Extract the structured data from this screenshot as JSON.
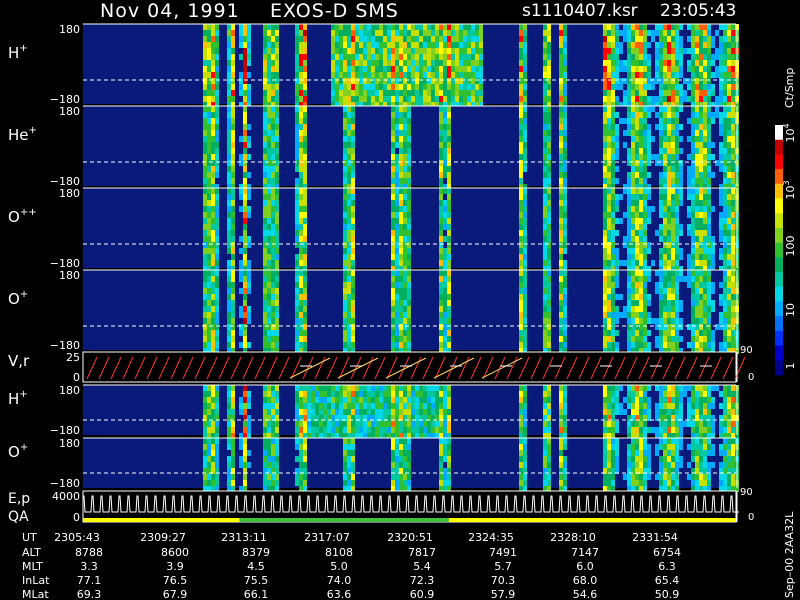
{
  "header": {
    "date": "Nov 04, 1991",
    "instrument": "EXOS-D SMS",
    "file": "s1110407.ksr",
    "time": "23:05:43"
  },
  "colorbar": {
    "unit": "Ct/Smp",
    "ticks": [
      "1",
      "10",
      "100",
      "10",
      "10"
    ],
    "tick_exponents": [
      "",
      "",
      "",
      "3",
      "4"
    ],
    "colors": [
      "#00008b",
      "#0000cd",
      "#0030ff",
      "#0070ff",
      "#00aaff",
      "#00d8e8",
      "#00c8a0",
      "#00b060",
      "#30c030",
      "#80d020",
      "#c8e000",
      "#ffff00",
      "#ffc000",
      "#ff6000",
      "#ff0000",
      "#c00000",
      "#ffffff"
    ]
  },
  "panels": [
    {
      "id": "p1",
      "label": "H",
      "sup": "+",
      "top_tick": "180",
      "bottom_tick": "−180",
      "intensity": 0.9
    },
    {
      "id": "p2",
      "label": "He",
      "sup": "+",
      "top_tick": "180",
      "bottom_tick": "−180",
      "intensity": 0.55
    },
    {
      "id": "p3",
      "label": "O",
      "sup": "++",
      "top_tick": "180",
      "bottom_tick": "−180",
      "intensity": 0.55
    },
    {
      "id": "p4",
      "label": "O",
      "sup": "+",
      "top_tick": "180",
      "bottom_tick": "−180",
      "intensity": 0.6
    },
    {
      "id": "p5",
      "label": "V,r",
      "sup": "",
      "top_tick": "25",
      "bottom_tick": "0",
      "right_tick_top": "90",
      "right_tick_bottom": "0"
    },
    {
      "id": "p6",
      "label": "H",
      "sup": "+",
      "top_tick": "180",
      "bottom_tick": "−180",
      "intensity": 0.7
    },
    {
      "id": "p7",
      "label": "O",
      "sup": "+",
      "top_tick": "180",
      "bottom_tick": "−180",
      "intensity": 0.45
    },
    {
      "id": "p8",
      "label_top": "E,p",
      "label_bottom": "QA",
      "top_tick": "4000",
      "bottom_tick": "0",
      "right_tick_top": "90",
      "right_tick_bottom": "0"
    }
  ],
  "footer": {
    "row_labels": [
      "UT",
      "ALT",
      "MLT",
      "InLat",
      "MLat"
    ],
    "columns": [
      [
        "2305:43",
        "8788",
        "3.3",
        "77.1",
        "69.3"
      ],
      [
        "2309:27",
        "8600",
        "3.9",
        "76.5",
        "67.9"
      ],
      [
        "2313:11",
        "8379",
        "4.5",
        "75.5",
        "66.1"
      ],
      [
        "2317:07",
        "8108",
        "5.0",
        "74.0",
        "63.6"
      ],
      [
        "2320:51",
        "7817",
        "5.4",
        "72.3",
        "60.9"
      ],
      [
        "2324:35",
        "7491",
        "5.7",
        "70.3",
        "57.9"
      ],
      [
        "2328:10",
        "7147",
        "6.0",
        "68.0",
        "54.6"
      ],
      [
        "2331:54",
        "6754",
        "6.3",
        "65.4",
        "50.9"
      ]
    ],
    "side_note": "Sep–00  2AA32L"
  },
  "qa_bar": {
    "segments": [
      {
        "color": "#ffff00",
        "frac": 0.24
      },
      {
        "color": "#40c040",
        "frac": 0.32
      },
      {
        "color": "#ffff00",
        "frac": 0.44
      }
    ]
  },
  "chart_data": {
    "type": "heatmap",
    "title": "Nov 04, 1991   EXOS-D SMS",
    "x": [
      "2305:43",
      "2309:27",
      "2313:11",
      "2317:07",
      "2320:51",
      "2324:35",
      "2328:10",
      "2331:54"
    ],
    "xlabel": "UT",
    "colorbar_label": "Ct/Smp",
    "colorbar_range": [
      1,
      10000
    ],
    "colorbar_scale": "log",
    "series": [
      {
        "name": "H+",
        "ylim": [
          -180,
          180
        ]
      },
      {
        "name": "He+",
        "ylim": [
          -180,
          180
        ]
      },
      {
        "name": "O++",
        "ylim": [
          -180,
          180
        ]
      },
      {
        "name": "O+",
        "ylim": [
          -180,
          180
        ]
      },
      {
        "name": "V,r",
        "ylim": [
          0,
          25
        ]
      },
      {
        "name": "H+",
        "ylim": [
          -180,
          180
        ]
      },
      {
        "name": "O+",
        "ylim": [
          -180,
          180
        ]
      },
      {
        "name": "E,p",
        "ylim": [
          0,
          4000
        ]
      }
    ]
  }
}
